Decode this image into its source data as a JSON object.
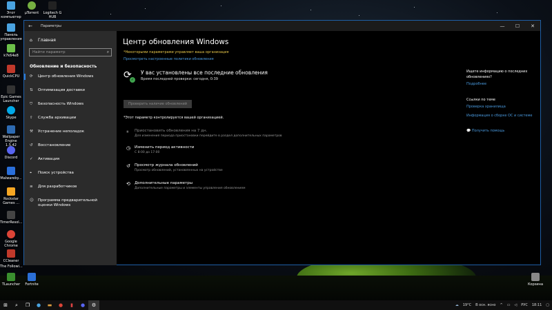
{
  "desktop_icons": [
    {
      "label": "Этот компьютер",
      "color": "#4aa3e0"
    },
    {
      "label": "μTorrent",
      "color": "#76b041"
    },
    {
      "label": "Logitech G HUB",
      "color": "#222"
    },
    {
      "label": "Панель управления",
      "color": "#4aa3e0"
    },
    {
      "label": "k7k64e8",
      "color": "#6cc04a"
    },
    {
      "label": "QuickCPU",
      "color": "#c0392b"
    },
    {
      "label": "Epic Games Launcher",
      "color": "#333"
    },
    {
      "label": "Skype",
      "color": "#00a8e8"
    },
    {
      "label": "Wallpaper Engine 1.5.42",
      "color": "#2d6bb3"
    },
    {
      "label": "Discord",
      "color": "#5865f2"
    },
    {
      "label": "Malwareby...",
      "color": "#2a6fdb"
    },
    {
      "label": "Rockstar Games ...",
      "color": "#f5a623"
    },
    {
      "label": "TimerResol...",
      "color": "#444"
    },
    {
      "label": "Google Chrome",
      "color": "#db4437"
    },
    {
      "label": "CCleaner",
      "color": "#c0392b"
    },
    {
      "label": "The Followi...",
      "color": "#666"
    },
    {
      "label": "TLauncher",
      "color": "#3a8f2e"
    },
    {
      "label": "Fortnite",
      "color": "#2b6fd6"
    },
    {
      "label": "Корзина",
      "color": "#888"
    }
  ],
  "window": {
    "title": "Параметры",
    "back_glyph": "←",
    "minimize": "—",
    "maximize": "☐",
    "close": "✕"
  },
  "sidebar": {
    "home": "Главная",
    "search_placeholder": "Найти параметр",
    "section_title": "Обновление и безопасность",
    "items": [
      {
        "label": "Центр обновления Windows",
        "icon": "refresh-icon"
      },
      {
        "label": "Оптимизация доставки",
        "icon": "delivery-icon"
      },
      {
        "label": "Безопасность Windows",
        "icon": "shield-icon"
      },
      {
        "label": "Служба архивации",
        "icon": "backup-icon"
      },
      {
        "label": "Устранение неполадок",
        "icon": "wrench-icon"
      },
      {
        "label": "Восстановление",
        "icon": "recovery-icon"
      },
      {
        "label": "Активация",
        "icon": "activation-icon"
      },
      {
        "label": "Поиск устройства",
        "icon": "find-device-icon"
      },
      {
        "label": "Для разработчиков",
        "icon": "developer-icon"
      },
      {
        "label": "Программа предварительной оценки Windows",
        "icon": "insider-icon"
      }
    ]
  },
  "main": {
    "title": "Центр обновления Windows",
    "org_note": "*Некоторыми параметрами управляет ваша организация",
    "policy_link": "Просмотреть настроенные политики обновления",
    "status_heading": "У вас установлены все последние обновления",
    "status_sub": "Время последней проверки: сегодня, 0:39",
    "check_button": "Проверить наличие обновлений",
    "managed_note": "*Этот параметр контролируется вашей организацией.",
    "options": [
      {
        "title": "Приостановить обновления на 7 дн.",
        "desc": "Для изменения периода приостановки перейдите в раздел дополнительных параметров",
        "dim": true,
        "icon": "pause-icon"
      },
      {
        "title": "Изменить период активности",
        "desc": "С 8:00 до 17:00",
        "dim": false,
        "icon": "clock-icon"
      },
      {
        "title": "Просмотр журнала обновлений",
        "desc": "Просмотр обновлений, установленных на устройстве",
        "dim": false,
        "icon": "history-icon"
      },
      {
        "title": "Дополнительные параметры",
        "desc": "Дополнительные параметры и элементы управления обновлением",
        "dim": false,
        "icon": "advanced-settings-icon"
      }
    ]
  },
  "right": {
    "question": "Ищете информацию о последних обновлениях?",
    "more_link": "Подробнее",
    "related_title": "Ссылки по теме",
    "link_storage": "Проверка хранилища",
    "link_build": "Информация о сборке ОС и системе",
    "help_link": "Получить помощь"
  },
  "taskbar": {
    "weather": "19°C",
    "weather_text": "В осн. ясно",
    "lang": "РУС",
    "time": "18:11"
  }
}
